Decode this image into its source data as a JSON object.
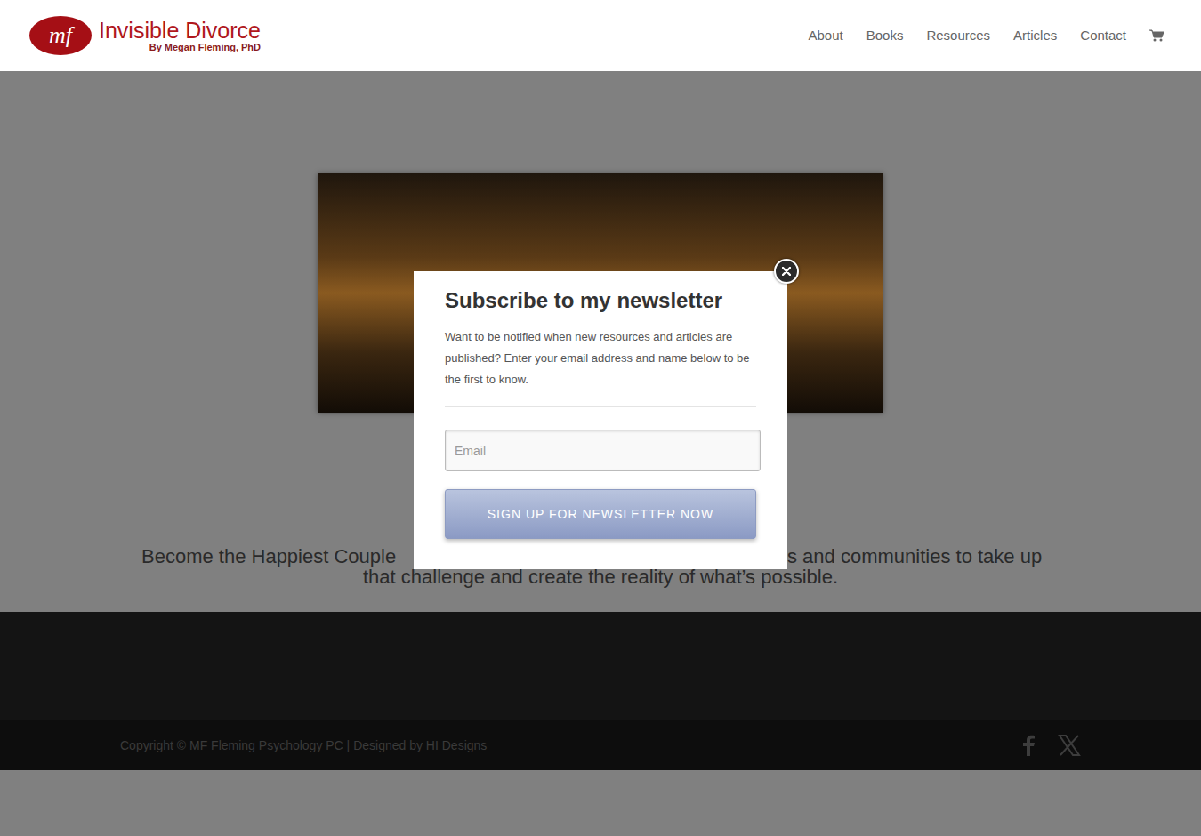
{
  "header": {
    "logo": {
      "mark": "mf",
      "title": "Invisible Divorce",
      "subtitle": "By Megan Fleming, PhD"
    },
    "nav": [
      "About",
      "Books",
      "Resources",
      "Articles",
      "Contact"
    ]
  },
  "hero": {
    "tagline_left": "Become the Happiest Couple",
    "tagline_right": "s and communities to take up",
    "tagline_line2": "that challenge and create the reality of what’s possible."
  },
  "footer": {
    "copyright": "Copyright © MF Fleming Psychology PC | Designed by HI Designs"
  },
  "modal": {
    "title": "Subscribe to my newsletter",
    "body": "Want to be notified when new resources and articles are published? Enter your email address and name below to be the first to know.",
    "email_placeholder": "Email",
    "button": "SIGN UP FOR NEWSLETTER NOW"
  }
}
